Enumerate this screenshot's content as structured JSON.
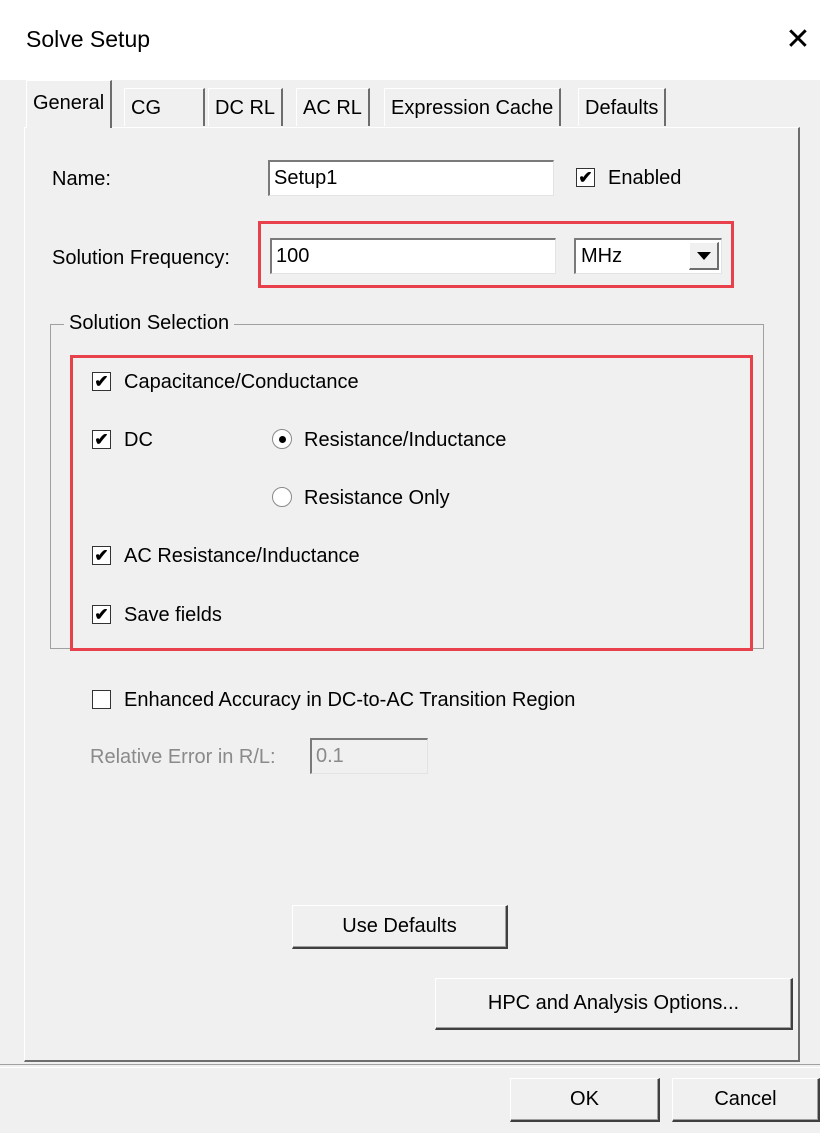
{
  "window": {
    "title": "Solve Setup",
    "close_glyph": "✕"
  },
  "tabs": [
    {
      "label": "General",
      "active": true
    },
    {
      "label": "CG"
    },
    {
      "label": "DC RL"
    },
    {
      "label": "AC RL"
    },
    {
      "label": "Expression Cache"
    },
    {
      "label": "Defaults"
    }
  ],
  "general": {
    "name_label": "Name:",
    "name_value": "Setup1",
    "enabled_label": "Enabled",
    "enabled_checked": true,
    "freq_label": "Solution Frequency:",
    "freq_value": "100",
    "freq_unit": "MHz",
    "solution_selection": {
      "title": "Solution Selection",
      "cap_label": "Capacitance/Conductance",
      "dc_label": "DC",
      "res_ind_label": "Resistance/Inductance",
      "res_only_label": "Resistance Only",
      "ac_label": "AC Resistance/Inductance",
      "save_fields_label": "Save fields"
    },
    "enhanced_label": "Enhanced Accuracy in DC-to-AC Transition Region",
    "rel_error_label": "Relative Error in R/L:",
    "rel_error_value": "0.1",
    "use_defaults_label": "Use Defaults",
    "hpc_label": "HPC and Analysis Options..."
  },
  "footer": {
    "ok_label": "OK",
    "cancel_label": "Cancel"
  },
  "colors": {
    "highlight": "#e8414b",
    "background": "#f0f0f0"
  },
  "check_glyph": "✔"
}
